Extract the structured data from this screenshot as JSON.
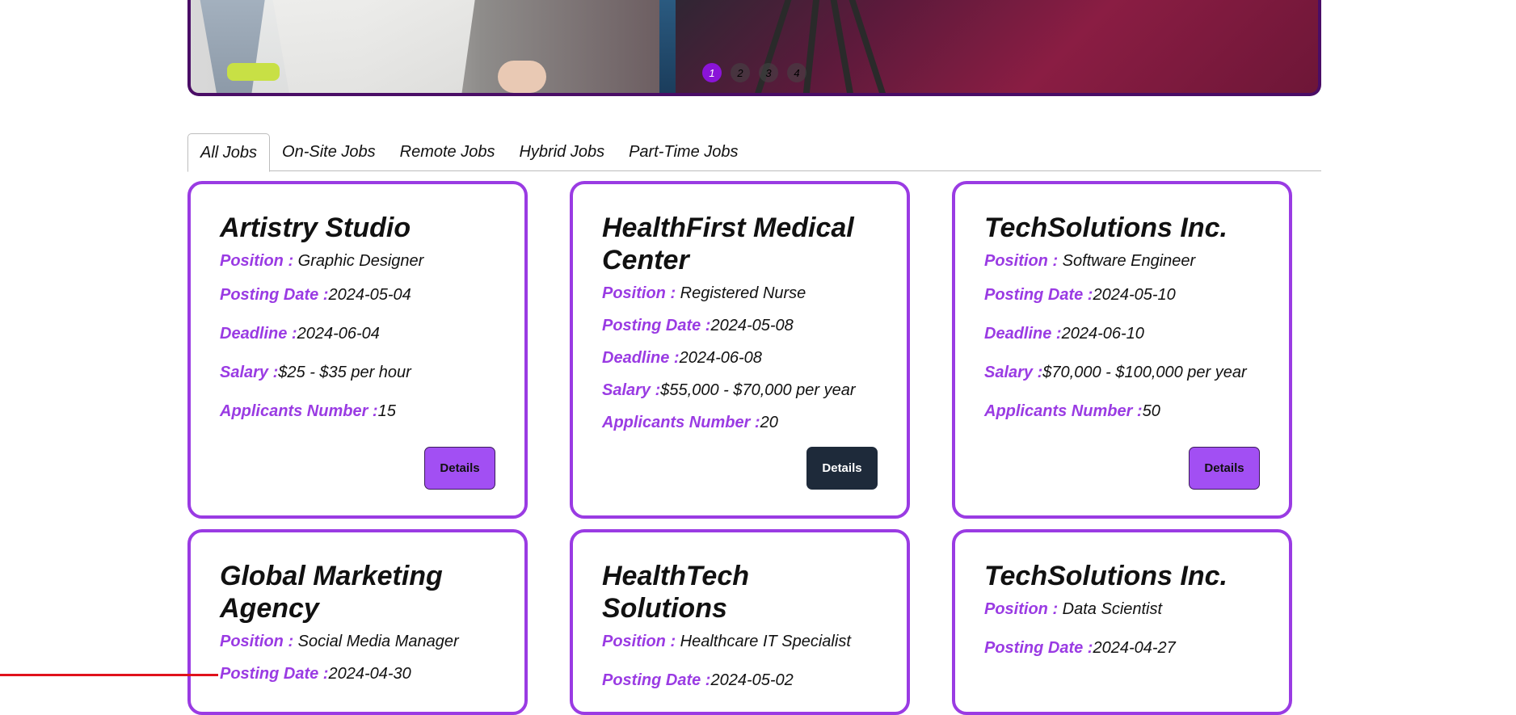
{
  "carousel": {
    "dots": [
      "1",
      "2",
      "3",
      "4"
    ],
    "active_index": 0
  },
  "tabs": [
    {
      "label": "All Jobs",
      "active": true
    },
    {
      "label": "On-Site Jobs",
      "active": false
    },
    {
      "label": "Remote Jobs",
      "active": false
    },
    {
      "label": "Hybrid Jobs",
      "active": false
    },
    {
      "label": "Part-Time Jobs",
      "active": false
    }
  ],
  "labels": {
    "position": "Position : ",
    "posting_date": "Posting Date :",
    "deadline": "Deadline :",
    "salary": "Salary :",
    "applicants": "Applicants Number :",
    "details": "Details"
  },
  "jobs": [
    {
      "company": "Artistry Studio",
      "position": "Graphic Designer",
      "posting_date": "2024-05-04",
      "deadline": "2024-06-04",
      "salary": "$25 - $35 per hour",
      "applicants": "15",
      "details_style": "purple"
    },
    {
      "company": "HealthFirst Medical Center",
      "position": "Registered Nurse",
      "posting_date": "2024-05-08",
      "deadline": "2024-06-08",
      "salary": "$55,000 - $70,000 per year",
      "applicants": "20",
      "details_style": "dark"
    },
    {
      "company": "TechSolutions Inc.",
      "position": "Software Engineer",
      "posting_date": "2024-05-10",
      "deadline": "2024-06-10",
      "salary": "$70,000 - $100,000 per year",
      "applicants": "50",
      "details_style": "purple"
    },
    {
      "company": "Global Marketing Agency",
      "position": "Social Media Manager",
      "posting_date": "2024-04-30"
    },
    {
      "company": "HealthTech Solutions",
      "position": "Healthcare IT Specialist",
      "posting_date": "2024-05-02"
    },
    {
      "company": "TechSolutions Inc.",
      "position": "Data Scientist",
      "posting_date": "2024-04-27"
    }
  ],
  "colors": {
    "accent_purple": "#9a3be3",
    "button_purple": "#a24ff3",
    "button_dark": "#1e2a3a",
    "carousel_active": "#8a14d8",
    "banner_border": "#4a0d66"
  }
}
